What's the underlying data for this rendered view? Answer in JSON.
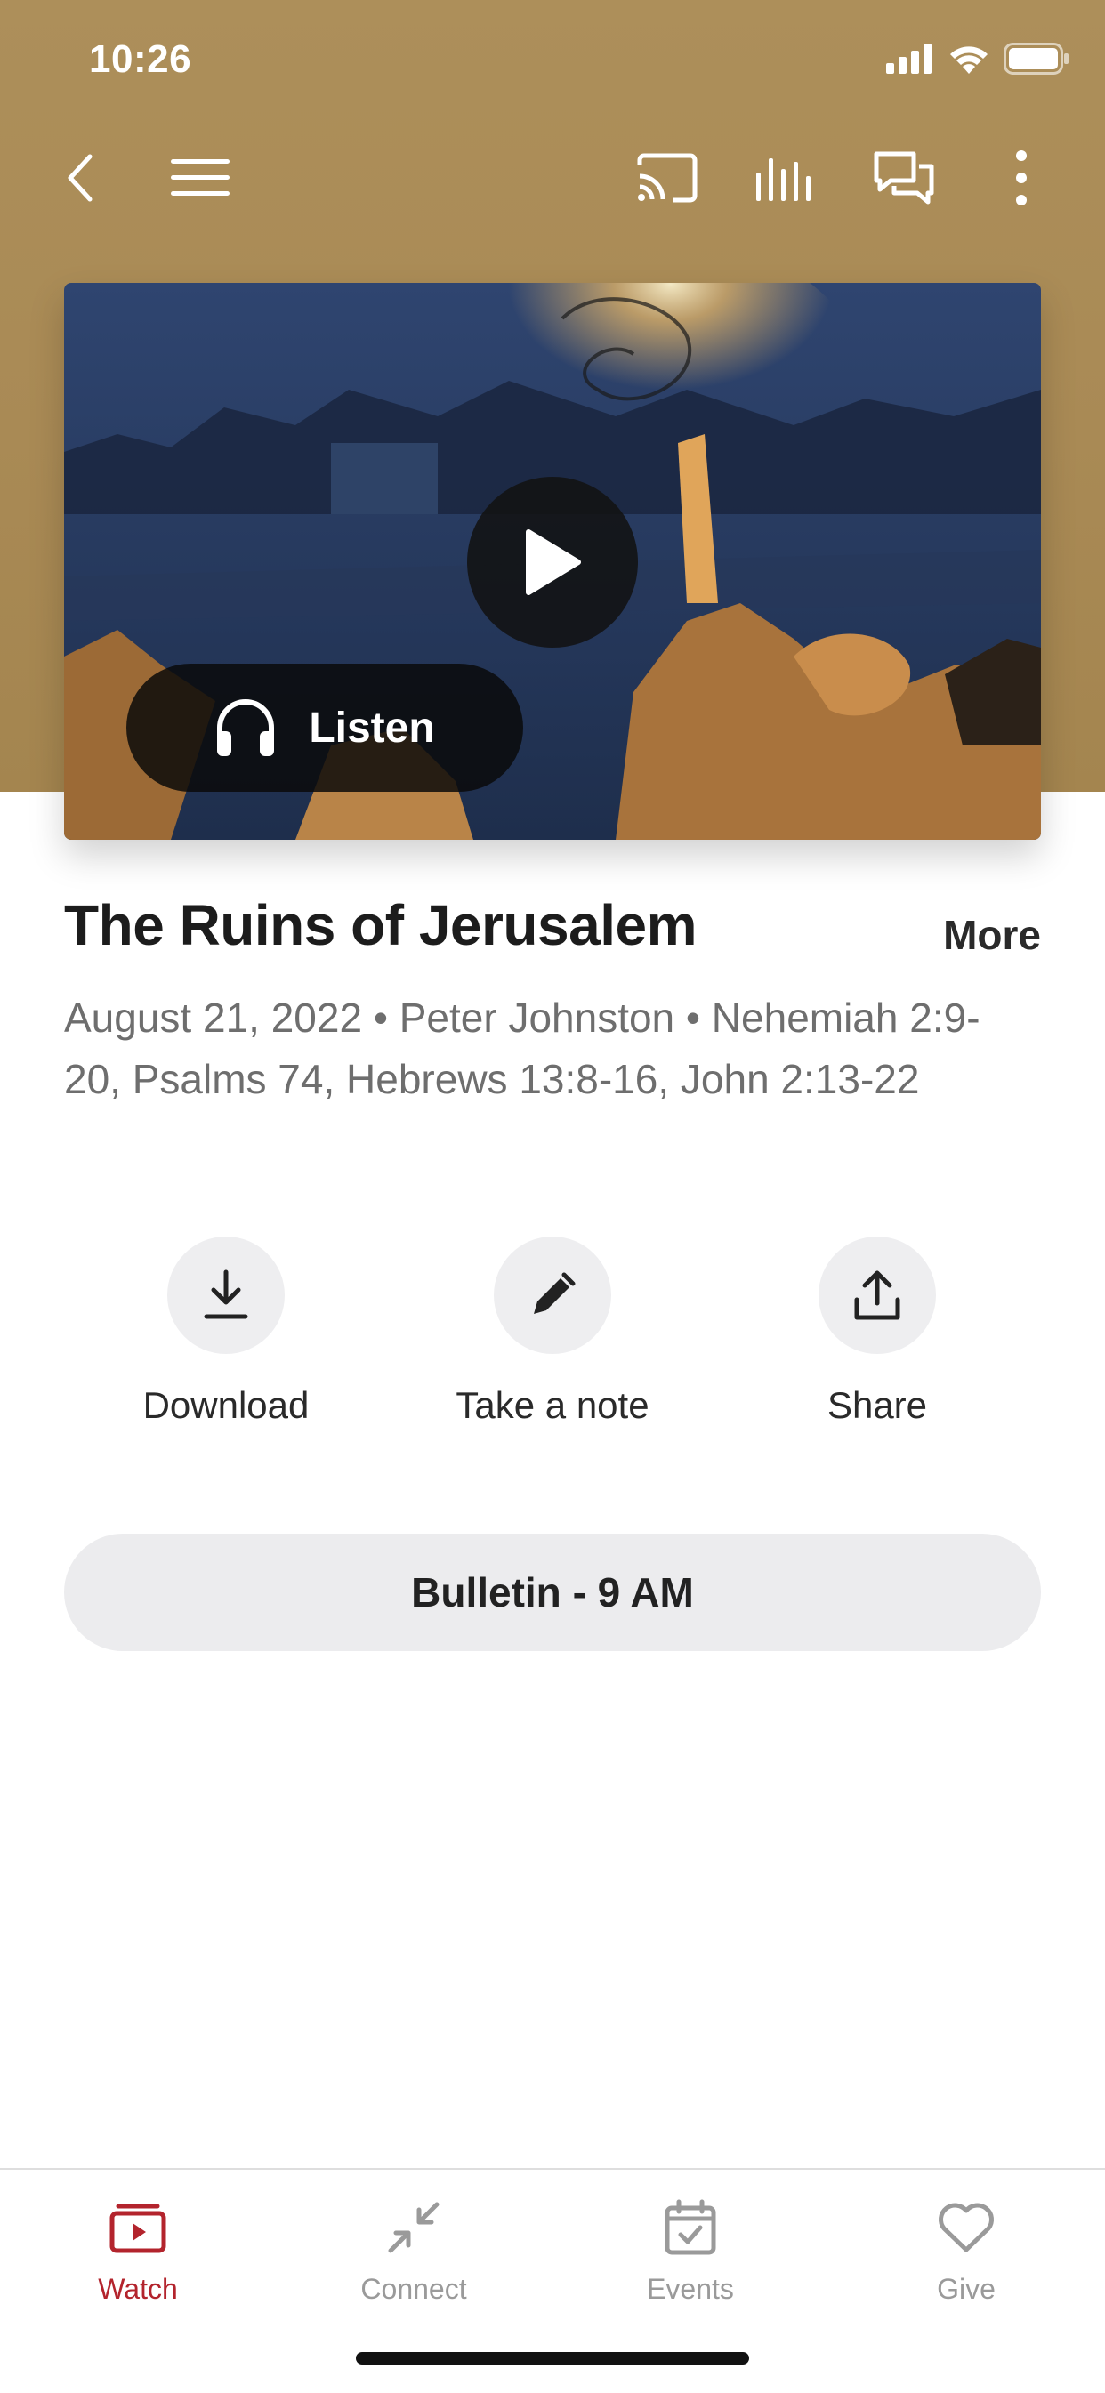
{
  "status_bar": {
    "time": "10:26"
  },
  "toolbar": {
    "icons": [
      "back-icon",
      "menu-icon",
      "cast-icon",
      "audio-bars-icon",
      "chat-icon",
      "more-vertical-icon"
    ]
  },
  "media": {
    "listen_label": "Listen",
    "play_icon": "play-icon",
    "listen_icon": "headphones-icon"
  },
  "sermon": {
    "title": "The Ruins of Jerusalem",
    "more_label": "More",
    "meta": "August 21, 2022 • Peter Johnston • Nehemiah 2:9-20, Psalms 74, Hebrews 13:8-16, John 2:13-22"
  },
  "actions": [
    {
      "label": "Download",
      "icon": "download-icon"
    },
    {
      "label": "Take a note",
      "icon": "pencil-icon"
    },
    {
      "label": "Share",
      "icon": "share-icon"
    }
  ],
  "bulletin": {
    "label": "Bulletin - 9 AM"
  },
  "tabs": [
    {
      "label": "Watch",
      "icon": "watch-icon",
      "active": true
    },
    {
      "label": "Connect",
      "icon": "connect-icon",
      "active": false
    },
    {
      "label": "Events",
      "icon": "calendar-icon",
      "active": false
    },
    {
      "label": "Give",
      "icon": "heart-icon",
      "active": false
    }
  ],
  "colors": {
    "header_gold": "#ad8f5a",
    "accent_red": "#b3242d",
    "tab_inactive": "#9a9a9a",
    "pill_gray": "#ececee"
  }
}
